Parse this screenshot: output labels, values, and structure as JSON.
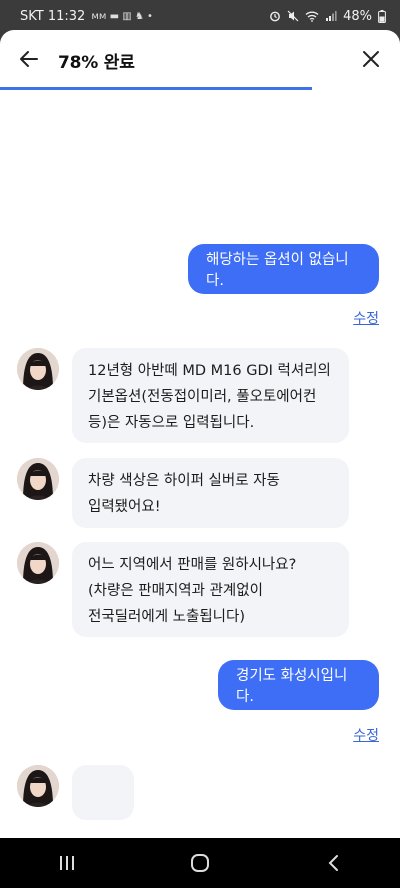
{
  "status_bar": {
    "carrier_time": "SKT 11:32",
    "extra_icons": "ᴍᴍ ▬ ▥ ♞ •",
    "battery": "48%"
  },
  "header": {
    "title": "78% 완료",
    "progress": 0.78
  },
  "messages": {
    "user_1": "해당하는 옵션이 없습니다.",
    "edit_1": "수정",
    "bot_1": [
      "12년형 아반떼 MD M16 GDI 럭셔리의",
      "기본옵션(전동접이미러, 풀오토에어컨",
      "등)은 자동으로 입력됩니다."
    ],
    "bot_2": [
      "차량 색상은 하이퍼 실버로 자동",
      "입력됐어요!"
    ],
    "bot_3": [
      "어느 지역에서 판매를 원하시나요?",
      "(차량은 판매지역과 관계없이",
      "전국딜러에게 노출됩니다)"
    ],
    "user_2": "경기도 화성시입니다.",
    "edit_2": "수정"
  },
  "colors": {
    "accent": "#3d6ef5",
    "bot_bubble": "#f3f4f8",
    "progress": "#3d73e6"
  },
  "icons": {
    "back": "arrow-left-icon",
    "close": "close-icon",
    "nav_recent": "recent-apps-icon",
    "nav_home": "home-icon",
    "nav_back": "nav-back-icon"
  }
}
